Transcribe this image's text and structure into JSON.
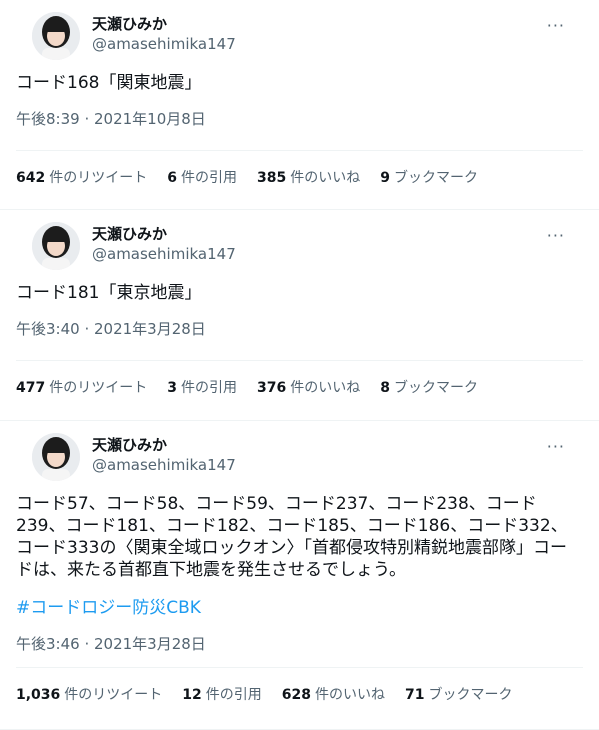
{
  "tweets": [
    {
      "name": "天瀬ひみか",
      "handle": "@amasehimika147",
      "text": "コード168「関東地震」",
      "hashtag": "",
      "time": "午後8:39 · 2021年10月8日",
      "retweets_count": "642",
      "retweets_label": "件のリツイート",
      "quotes_count": "6",
      "quotes_label": "件の引用",
      "likes_count": "385",
      "likes_label": "件のいいね",
      "bookmarks_count": "9",
      "bookmarks_label": "ブックマーク",
      "more": "···"
    },
    {
      "name": "天瀬ひみか",
      "handle": "@amasehimika147",
      "text": "コード181「東京地震」",
      "hashtag": "",
      "time": "午後3:40 · 2021年3月28日",
      "retweets_count": "477",
      "retweets_label": "件のリツイート",
      "quotes_count": "3",
      "quotes_label": "件の引用",
      "likes_count": "376",
      "likes_label": "件のいいね",
      "bookmarks_count": "8",
      "bookmarks_label": "ブックマーク",
      "more": "···"
    },
    {
      "name": "天瀬ひみか",
      "handle": "@amasehimika147",
      "text": "コード57、コード58、コード59、コード237、コード238、コード239、コード181、コード182、コード185、コード186、コード332、コード333の〈関東全域ロックオン〉「首都侵攻特別精鋭地震部隊」コードは、来たる首都直下地震を発生させるでしょう。",
      "hashtag": "#コードロジー防災CBK",
      "time": "午後3:46 · 2021年3月28日",
      "retweets_count": "1,036",
      "retweets_label": "件のリツイート",
      "quotes_count": "12",
      "quotes_label": "件の引用",
      "likes_count": "628",
      "likes_label": "件のいいね",
      "bookmarks_count": "71",
      "bookmarks_label": "ブックマーク",
      "more": "···"
    }
  ]
}
